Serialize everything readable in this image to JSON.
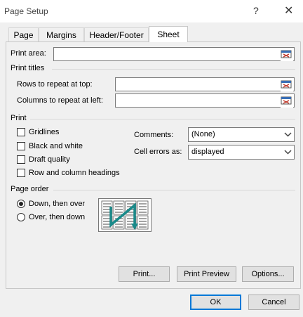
{
  "window": {
    "title": "Page Setup",
    "help_glyph": "?",
    "close_glyph": "✕"
  },
  "tabs": [
    {
      "label": "Page"
    },
    {
      "label": "Margins"
    },
    {
      "label": "Header/Footer"
    },
    {
      "label": "Sheet",
      "active": true
    }
  ],
  "print_area": {
    "label": "Print area:",
    "value": ""
  },
  "print_titles": {
    "title": "Print titles",
    "rows_label": "Rows to repeat at top:",
    "rows_value": "",
    "cols_label": "Columns to repeat at left:",
    "cols_value": ""
  },
  "print_options": {
    "title": "Print",
    "gridlines": {
      "label": "Gridlines",
      "checked": false
    },
    "black_white": {
      "label": "Black and white",
      "checked": false
    },
    "draft": {
      "label": "Draft quality",
      "checked": false
    },
    "headings": {
      "label": "Row and column headings",
      "checked": false
    },
    "comments_label": "Comments:",
    "comments_value": "(None)",
    "cell_errors_label": "Cell errors as:",
    "cell_errors_value": "displayed"
  },
  "page_order": {
    "title": "Page order",
    "down_over": {
      "label": "Down, then over",
      "selected": true
    },
    "over_down": {
      "label": "Over, then down",
      "selected": false
    }
  },
  "buttons": {
    "print": "Print...",
    "print_preview": "Print Preview",
    "options": "Options...",
    "ok": "OK",
    "cancel": "Cancel"
  },
  "colors": {
    "accent": "#0078d7",
    "preview_arrow": "#1a8a8a"
  }
}
